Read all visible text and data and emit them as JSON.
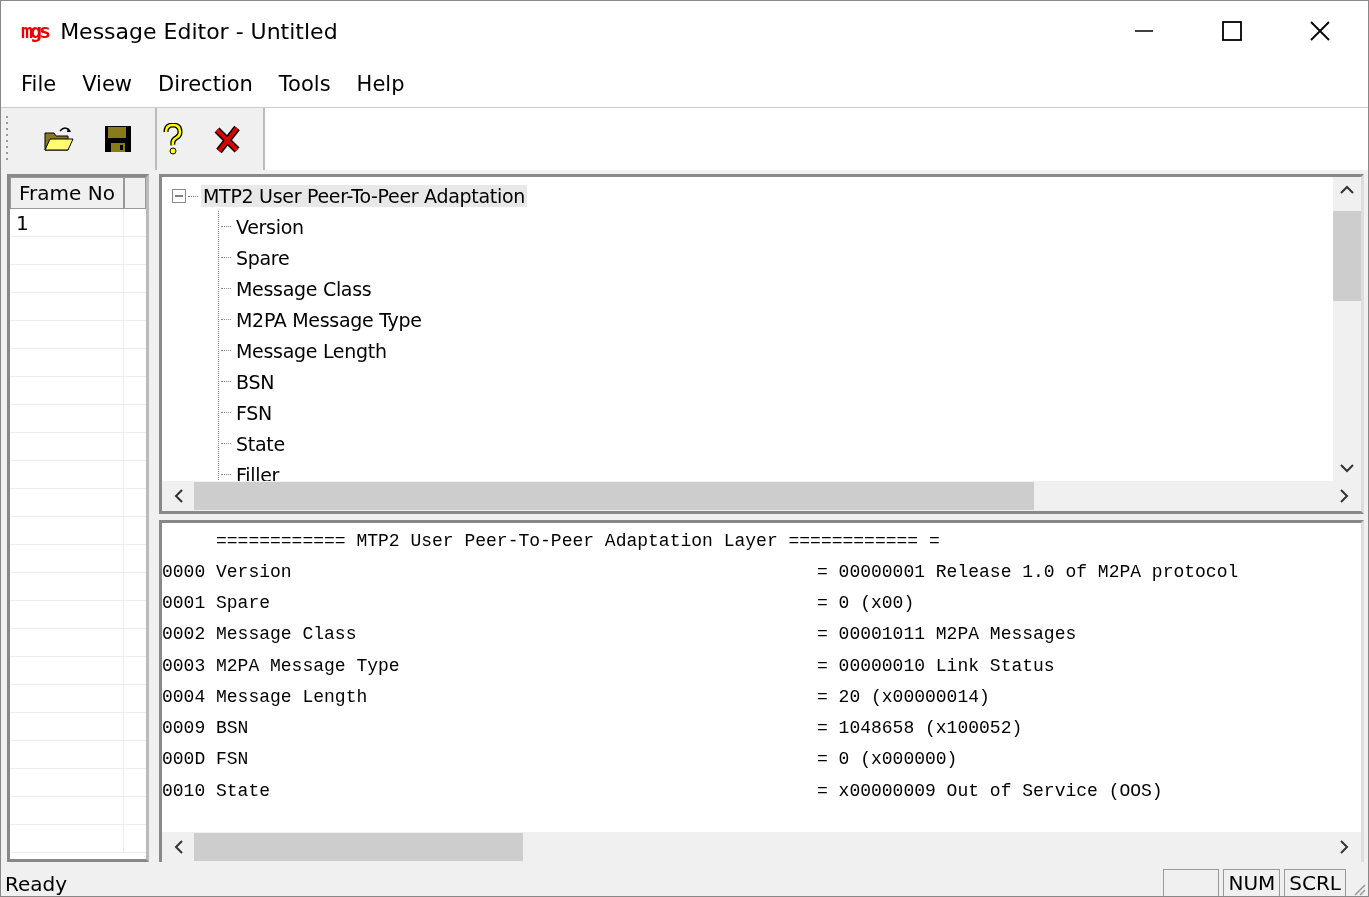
{
  "window": {
    "title": "Message Editor - Untitled",
    "logo_text": "mgs"
  },
  "menu": [
    "File",
    "View",
    "Direction",
    "Tools",
    "Help"
  ],
  "frame_list": {
    "header": "Frame No",
    "rows": [
      "1"
    ]
  },
  "tree": {
    "label": "MTP2 User Peer-To-Peer Adaptation",
    "expanded": true,
    "selected": true,
    "children": [
      {
        "label": "Version"
      },
      {
        "label": "Spare"
      },
      {
        "label": "Message Class"
      },
      {
        "label": "M2PA Message Type"
      },
      {
        "label": "Message Length"
      },
      {
        "label": "BSN"
      },
      {
        "label": "FSN"
      },
      {
        "label": "State"
      },
      {
        "label": "Filler"
      }
    ]
  },
  "detail": {
    "header": "============ MTP2 User Peer-To-Peer Adaptation Layer ============ =",
    "rows": [
      {
        "field": "0000 Version",
        "value": "= 00000001 Release 1.0 of M2PA protocol"
      },
      {
        "field": "0001 Spare",
        "value": "= 0 (x00)"
      },
      {
        "field": "0002 Message Class",
        "value": "= 00001011 M2PA Messages"
      },
      {
        "field": "0003 M2PA Message Type",
        "value": "= 00000010 Link Status"
      },
      {
        "field": "0004 Message Length",
        "value": "= 20 (x00000014)"
      },
      {
        "field": "0009 BSN",
        "value": "= 1048658 (x100052)"
      },
      {
        "field": "000D FSN",
        "value": "= 0 (x000000)"
      },
      {
        "field": "0010 State",
        "value": "= x00000009 Out of Service (OOS)"
      }
    ]
  },
  "status_bar": {
    "message": "Ready",
    "indicators": [
      "NUM",
      "SCRL"
    ]
  }
}
